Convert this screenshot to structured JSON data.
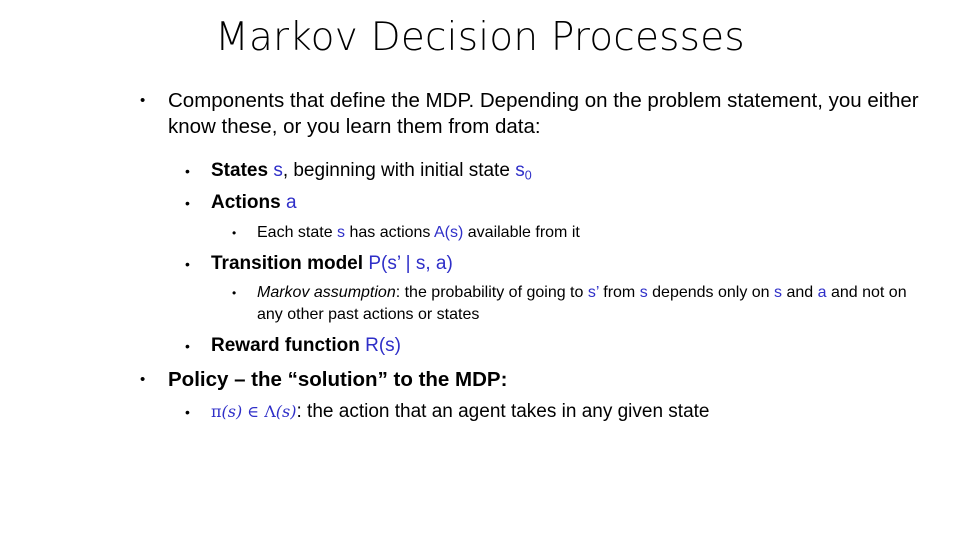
{
  "slide": {
    "title": "Markov Decision Processes",
    "bullet_glyph": "•",
    "colors": {
      "text": "#000000",
      "accent_blue": "#2f2fc8",
      "background": "#ffffff"
    },
    "intro": {
      "text": "Components that define the MDP.  Depending on the problem statement, you either know these, or you learn them from data:"
    },
    "states": {
      "label": "States",
      "var": "s",
      "mid": ", beginning with initial state ",
      "initial_var": "s",
      "initial_sub": "0"
    },
    "actions": {
      "label": "Actions",
      "var": "a"
    },
    "each_state": {
      "pre": "Each state ",
      "var_s": "s",
      "mid": " has actions ",
      "var_as": "A(s)",
      "post": " available from it"
    },
    "transition": {
      "label": "Transition model",
      "formula": "P(s’ | s, a)"
    },
    "markov": {
      "label": "Markov assumption",
      "part1": ": the probability of going to ",
      "var_sp": "s’",
      "part2": " from ",
      "var_s": "s",
      "part3": " depends only on ",
      "var_s2": "s",
      "part4": " and ",
      "var_a": "a",
      "part5": " and not on any other past actions or states"
    },
    "reward": {
      "label": "Reward function",
      "formula": "R(s)"
    },
    "policy": {
      "label": "Policy – the “solution” to the MDP:"
    },
    "pi": {
      "pi_symbol": "π",
      "pi_arg": "(s)",
      "elem": " ∈ ",
      "lambda_symbol": "Λ",
      "lambda_arg": "(s)",
      "colon": ":",
      "text": " the action that an agent takes in any given state"
    }
  }
}
